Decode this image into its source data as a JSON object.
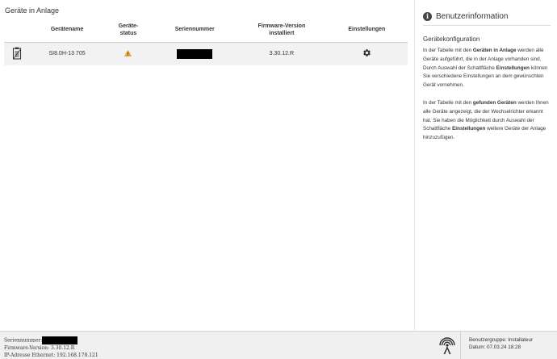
{
  "main": {
    "section_title": "Geräte in Anlage",
    "table": {
      "headers": {
        "name": "Gerätename",
        "status_line1": "Geräte-",
        "status_line2": "status",
        "serial": "Seriennummer",
        "firmware_line1": "Firmware-Version",
        "firmware_line2": "installiert",
        "settings": "Einstellungen"
      },
      "rows": [
        {
          "icon": "inverter-device-icon",
          "name": "SI8.0H-13 705",
          "status_icon": "warning-icon",
          "firmware": "3.30.12.R",
          "settings_icon": "gear-icon"
        }
      ]
    }
  },
  "aside": {
    "title": "Benutzerinformation",
    "subtitle": "Gerätekonfiguration",
    "p1_a": "In der Tabelle mit den ",
    "p1_b": "Geräten in Anlage",
    "p1_c": " werden alle Geräte aufgeführt, die in der Anlage vorhanden sind.",
    "p2_a": "Durch Auswahl der Schaltfläche ",
    "p2_b": "Einstellungen",
    "p2_c": " können Sie verschiedene Einstellungen an dem gewünschten Gerät vornehmen.",
    "p3_a": "In der Tabelle mit den ",
    "p3_b": "gefunden Geräten",
    "p3_c": " werden Ihnen alle Geräte angezeigt, die der Wechselrichter erkannt hat. Sie haben die Möglichkeit durch Auswahl der Schaltfläche ",
    "p3_d": "Einstellungen",
    "p3_e": " weitere Geräte der Anlage hinzuzufügen."
  },
  "footer": {
    "serial_label": "Seriennummer:",
    "firmware": "Firmware-Version: 3.30.12.R",
    "ip": "IP-Adresse Ethernet: 192.168.178.121",
    "user_group": "Benutzergruppe: Installateur",
    "date": "Datum: 07.03.24 18:28",
    "status_icon": "antenna-icon"
  },
  "colors": {
    "warning": "#f5a623",
    "footer_bg": "#f0f0f0",
    "row_bg": "#f2f2f2"
  }
}
